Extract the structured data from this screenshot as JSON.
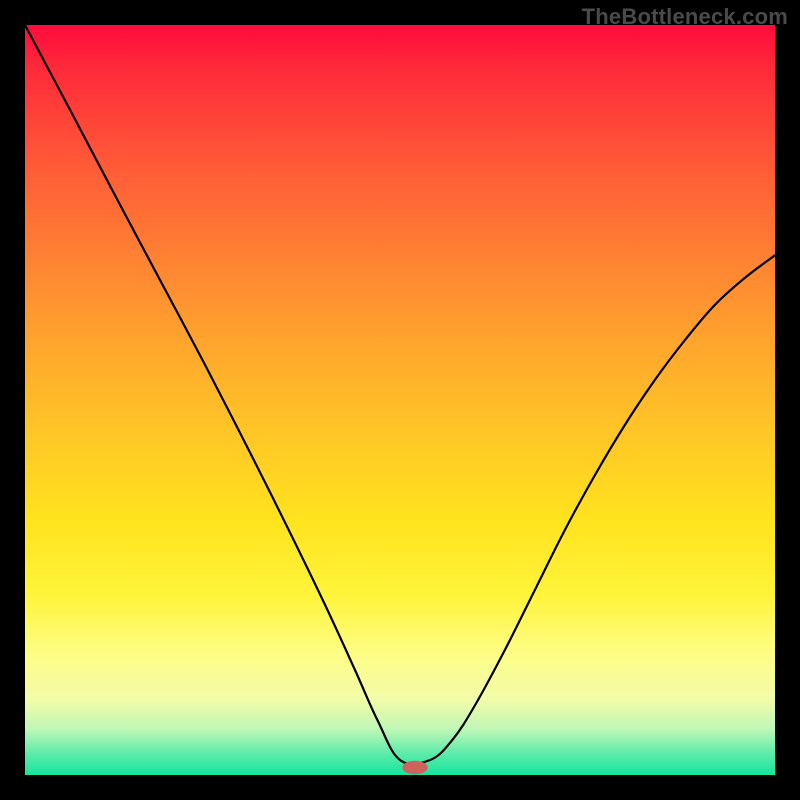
{
  "watermark": "TheBottleneck.com",
  "colors": {
    "background": "#000000",
    "curve": "#000000",
    "marker": "#d0625e",
    "gradient_stops": [
      {
        "pos": 0.0,
        "hex": "#ff0b3c"
      },
      {
        "pos": 0.06,
        "hex": "#ff2b3a"
      },
      {
        "pos": 0.18,
        "hex": "#ff5837"
      },
      {
        "pos": 0.3,
        "hex": "#ff7e33"
      },
      {
        "pos": 0.42,
        "hex": "#ffa42d"
      },
      {
        "pos": 0.54,
        "hex": "#ffc526"
      },
      {
        "pos": 0.66,
        "hex": "#ffe31e"
      },
      {
        "pos": 0.76,
        "hex": "#fff43a"
      },
      {
        "pos": 0.84,
        "hex": "#fdfd87"
      },
      {
        "pos": 0.9,
        "hex": "#f2fca9"
      },
      {
        "pos": 0.94,
        "hex": "#bcf7b6"
      },
      {
        "pos": 0.97,
        "hex": "#61ecab"
      },
      {
        "pos": 1.0,
        "hex": "#13e59d"
      }
    ]
  },
  "chart_data": {
    "type": "line",
    "title": "",
    "xlabel": "",
    "ylabel": "",
    "xlim": [
      0,
      1
    ],
    "ylim": [
      0,
      1
    ],
    "note": "x and y are normalized fractions of the plot area (0,0 = bottom-left; 1,1 = top-right). y values read off the gradient height; higher y = worse (red), 0 = optimal (green). The minimum sits near x≈0.50–0.54.",
    "series": [
      {
        "name": "curve",
        "x": [
          0.0,
          0.06,
          0.12,
          0.18,
          0.24,
          0.3,
          0.35,
          0.4,
          0.44,
          0.47,
          0.5,
          0.54,
          0.57,
          0.6,
          0.64,
          0.68,
          0.72,
          0.76,
          0.8,
          0.84,
          0.88,
          0.92,
          0.96,
          1.0
        ],
        "y": [
          1.0,
          0.887,
          0.773,
          0.66,
          0.547,
          0.43,
          0.33,
          0.227,
          0.14,
          0.073,
          0.02,
          0.02,
          0.047,
          0.093,
          0.167,
          0.247,
          0.327,
          0.4,
          0.467,
          0.527,
          0.58,
          0.627,
          0.663,
          0.693
        ]
      }
    ],
    "marker": {
      "x": 0.52,
      "y": 0.01,
      "rx_frac": 0.017,
      "ry_frac": 0.009
    }
  }
}
